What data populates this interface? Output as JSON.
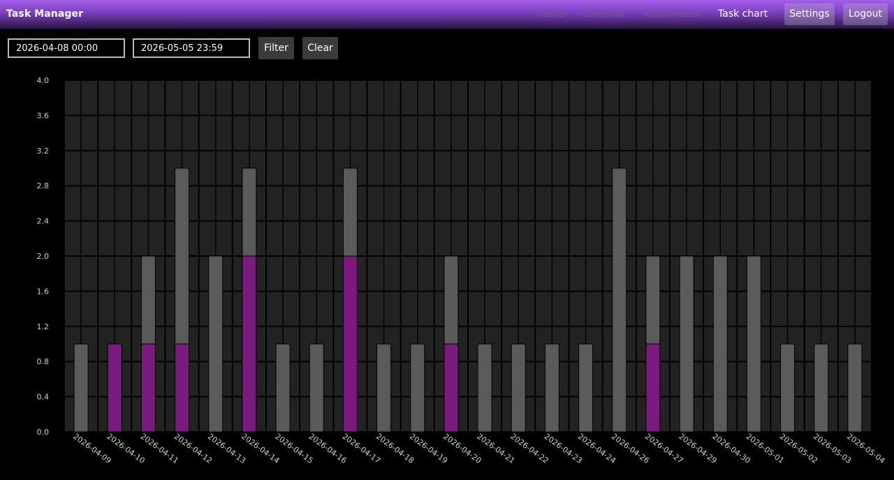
{
  "app": {
    "title": "Task Manager"
  },
  "nav": {
    "tasks": "Tasks",
    "calendar": "Calendar",
    "customers": "Customers",
    "task_chart": "Task chart",
    "settings": "Settings",
    "logout": "Logout"
  },
  "filter": {
    "from_value": "2026-04-08 00:00",
    "to_value": "2026-05-05 23:59",
    "filter_label": "Filter",
    "clear_label": "Clear"
  },
  "colors": {
    "accent": "#7a1a7e",
    "bar_gray": "#5a5a5a",
    "plot_bg": "#222222",
    "grid": "#000000",
    "text": "#cfcfcf"
  },
  "chart_data": {
    "type": "bar",
    "stacked": true,
    "grid": true,
    "ylim": [
      0,
      4
    ],
    "yticks": [
      "0.0",
      "0.4",
      "0.8",
      "1.2",
      "1.6",
      "2.0",
      "2.4",
      "2.8",
      "3.2",
      "3.6",
      "4.0"
    ],
    "categories": [
      "2026-04-09",
      "2026-04-10",
      "2026-04-11",
      "2026-04-12",
      "2026-04-13",
      "2026-04-14",
      "2026-04-15",
      "2026-04-16",
      "2026-04-17",
      "2026-04-18",
      "2026-04-19",
      "2026-04-20",
      "2026-04-21",
      "2026-04-22",
      "2026-04-23",
      "2026-04-24",
      "2026-04-26",
      "2026-04-27",
      "2026-04-29",
      "2026-04-30",
      "2026-05-01",
      "2026-05-02",
      "2026-05-03",
      "2026-05-04"
    ],
    "series": [
      {
        "color": "#7a1a7e",
        "values": [
          0,
          1,
          1,
          1,
          0,
          2,
          0,
          0,
          2,
          0,
          0,
          1,
          0,
          0,
          0,
          0,
          0,
          1,
          0,
          0,
          0,
          0,
          0,
          0
        ]
      },
      {
        "color": "#5a5a5a",
        "values": [
          1,
          0,
          1,
          2,
          2,
          1,
          1,
          1,
          1,
          1,
          1,
          1,
          1,
          1,
          1,
          1,
          3,
          1,
          2,
          2,
          2,
          1,
          1,
          1
        ]
      }
    ]
  }
}
